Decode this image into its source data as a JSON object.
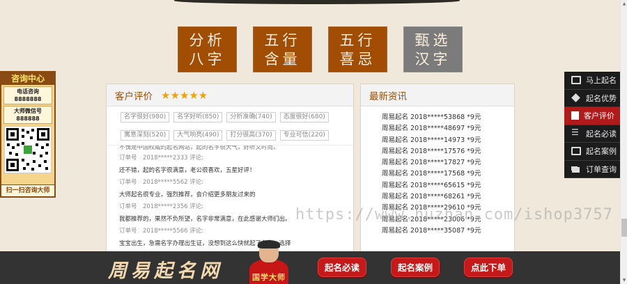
{
  "menu_tiles": [
    {
      "label": "分析八字",
      "line1": "分析",
      "line2": "八字",
      "color": "#a24d04"
    },
    {
      "label": "五行含量",
      "line1": "五行",
      "line2": "含量",
      "color": "#a24d04"
    },
    {
      "label": "五行喜忌",
      "line1": "五行",
      "line2": "喜忌",
      "color": "#a24d04"
    },
    {
      "label": "甄选汉字",
      "line1": "甄选",
      "line2": "汉字",
      "color": "#7b7b7b"
    }
  ],
  "consult": {
    "title": "咨询中心",
    "phone_label": "电话咨询",
    "phone": "8888888",
    "wechat_label": "大师微信号",
    "wechat": "888888",
    "scan_text": "扫一扫咨询大师"
  },
  "reviews": {
    "title": "客户评价",
    "stars": "★★★★★",
    "tags": [
      "名字很好(980)",
      "名字好听(850)",
      "分析准确(740)",
      "态度很好(680)",
      "寓意深刻(520)",
      "大气响亮(490)",
      "打分很高(370)",
      "专业可信(220)"
    ],
    "partial_top": "不愧是中国权威的起名网站，起的名字很大气，好听又时尚。",
    "items": [
      {
        "order": "订单号　2018*****2333 评论:",
        "comment": "还不错，起的名字很满意，老公很喜欢，五星好评！"
      },
      {
        "order": "订单号　2018*****5562 评论:",
        "comment": "大师起名很专业，强烈推荐，会介绍更多朋友过来的"
      },
      {
        "order": "订单号　2018*****2356 评论:",
        "comment": "我都推荐的，果然不负所望，名字非常满意，在此感谢大师们出。"
      },
      {
        "order": "订单号　2018*****5566 评论:",
        "comment": "宝宝出生，急需名字办理出生证，没想到这么快就起了名字，选择"
      }
    ]
  },
  "news": {
    "title": "最新资讯",
    "items": [
      "周易起名 2018*****53868 *9元",
      "周易起名 2018*****48697 *9元",
      "周易起名 2018*****14973 *9元",
      "周易起名 2018*****17576 *9元",
      "周易起名 2018*****17827 *9元",
      "周易起名 2018*****17568 *9元",
      "周易起名 2018*****65615 *9元",
      "周易起名 2018*****68261 *9元",
      "周易起名 2018*****29610 *9元",
      "周易起名 2018*****23006 *9元",
      "周易起名 2018*****35087 *9元"
    ]
  },
  "sidenav": [
    {
      "label": "马上起名",
      "icon": "id-card-icon",
      "active": false
    },
    {
      "label": "起名优势",
      "icon": "diamond-icon",
      "active": false
    },
    {
      "label": "客户评价",
      "icon": "document-icon",
      "active": true
    },
    {
      "label": "起名必读",
      "icon": "list-icon",
      "active": false
    },
    {
      "label": "起名案例",
      "icon": "id-card-icon",
      "active": false
    },
    {
      "label": "订单查询",
      "icon": "stack-icon",
      "active": false
    }
  ],
  "bottombar": {
    "logo": "周易起名网",
    "master_caption": "国学大师",
    "buttons": [
      "起名必读",
      "起名案例",
      "点此下单"
    ]
  },
  "watermark": "https://www.huzhan.com/ishop3757",
  "colors": {
    "brown": "#a24d04",
    "grey": "#7b7b7b",
    "active_red": "#b11a1a",
    "star_gold": "#f2a300"
  }
}
